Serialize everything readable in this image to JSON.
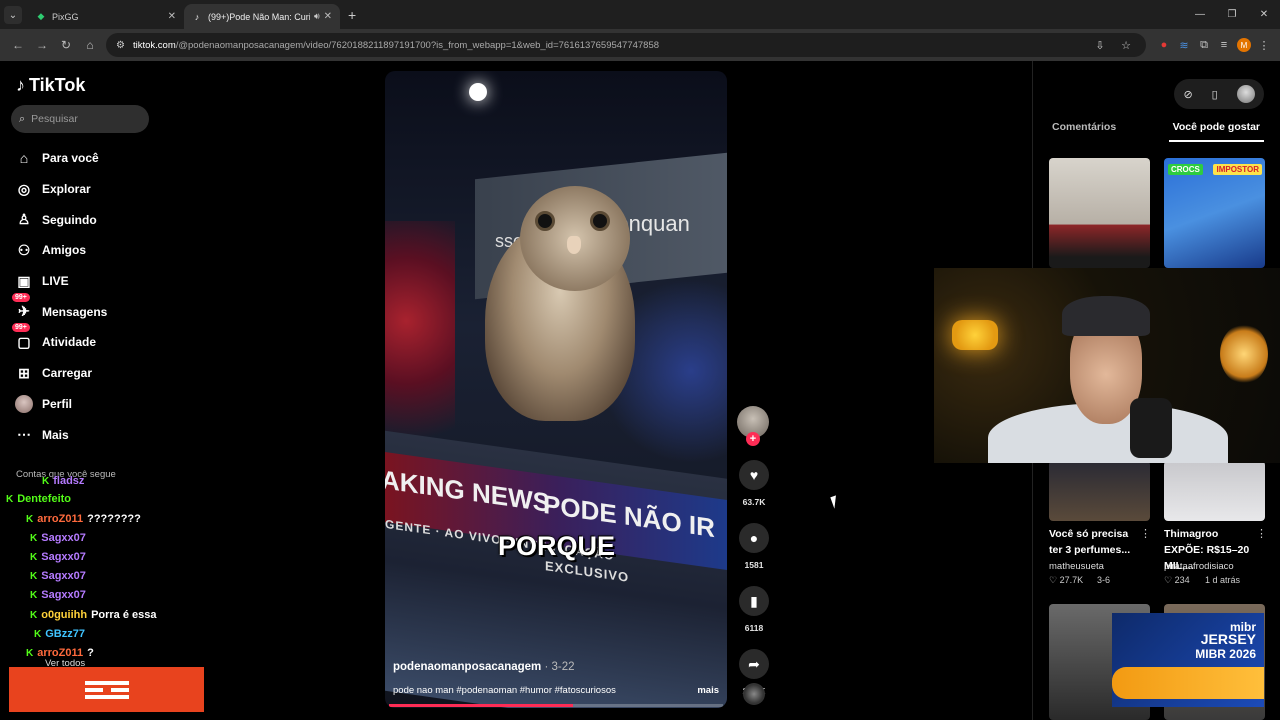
{
  "browser": {
    "tabs": [
      {
        "title": "PixGG",
        "active": false
      },
      {
        "title": "(99+)Pode Não Man: Curio",
        "active": true
      }
    ],
    "url_host": "tiktok.com",
    "url_path": "/@podenaomanposacanagem/video/7620188211897191700?is_from_webapp=1&web_id=7616137659547747858",
    "profile_initial": "M"
  },
  "tiktok": {
    "logo_text": "TikTok",
    "search_placeholder": "Pesquisar",
    "nav": [
      {
        "label": "Para você",
        "icon": "home-icon",
        "glyph": "⌂"
      },
      {
        "label": "Explorar",
        "icon": "compass-icon",
        "glyph": "◎"
      },
      {
        "label": "Seguindo",
        "icon": "following-icon",
        "glyph": "♙"
      },
      {
        "label": "Amigos",
        "icon": "friends-icon",
        "glyph": "⚇"
      },
      {
        "label": "LIVE",
        "icon": "live-icon",
        "glyph": "▣"
      },
      {
        "label": "Mensagens",
        "icon": "messages-icon",
        "glyph": "✈",
        "badge": "99+"
      },
      {
        "label": "Atividade",
        "icon": "activity-icon",
        "glyph": "▢",
        "badge": "99+"
      },
      {
        "label": "Carregar",
        "icon": "upload-icon",
        "glyph": "⊞"
      },
      {
        "label": "Perfil",
        "icon": "profile-icon",
        "glyph": ""
      },
      {
        "label": "Mais",
        "icon": "more-icon",
        "glyph": "⋯"
      }
    ],
    "following_title": "Contas que você segue",
    "see_all": "Ver todos"
  },
  "chat": [
    {
      "user": "fladsz",
      "msg": "",
      "color": "#b57bff"
    },
    {
      "user": "Dentefeito",
      "msg": "",
      "color": "#53fc18"
    },
    {
      "user": "arroZ011",
      "msg": "????????",
      "color": "#ff6a3d"
    },
    {
      "user": "Sagxx07",
      "msg": "",
      "color": "#b57bff"
    },
    {
      "user": "Sagxx07",
      "msg": "",
      "color": "#b57bff"
    },
    {
      "user": "Sagxx07",
      "msg": "",
      "color": "#b57bff"
    },
    {
      "user": "Sagxx07",
      "msg": "",
      "color": "#b57bff"
    },
    {
      "user": "o0guiihh",
      "msg": "Porra é essa",
      "color": "#ffd23a"
    },
    {
      "user": "GBzz77",
      "msg": "",
      "color": "#40c4ff"
    },
    {
      "user": "arroZ011",
      "msg": "?",
      "color": "#ff6a3d"
    }
  ],
  "video": {
    "screen_text": "r enquan",
    "screen_text2": "sso",
    "breaking": "AKING NEWS",
    "pode_nao": "PODE NÃO IR",
    "subline": "GENTE · AO VIVO · INVESTGAÇÃO",
    "subline2": "EXCLUSIVO",
    "caption": "PORQUE",
    "author": "podenaomanposacanagem",
    "date": " · 3-22",
    "description": "pode nao man #podenaoman #humor #fatoscuriosos",
    "more": "mais",
    "progress": 0.55
  },
  "actions": {
    "likes": "63.7K",
    "comments": "1581",
    "saves": "6118",
    "shares": "28.1K"
  },
  "right_panel": {
    "tab_comments": "Comentários",
    "tab_suggested": "Você pode gostar",
    "thumb2_tag1": "CROCS",
    "thumb2_tag2": "IMPOSTOR",
    "cards": [
      {
        "title": "Você só precisa ter 3 perfumes...",
        "author": "matheusueta",
        "likes": "♡ 27.7K",
        "date": "3-6"
      },
      {
        "title": "Thimagroo EXPÕE: R$15–20 MIL,...",
        "author": "pirataafrodisiaco",
        "likes": "♡ 234",
        "date": "1 d atrás"
      }
    ]
  },
  "sponsor": {
    "brand": "mibr",
    "line1": "JERSEY",
    "line2": "MIBR 2026"
  }
}
